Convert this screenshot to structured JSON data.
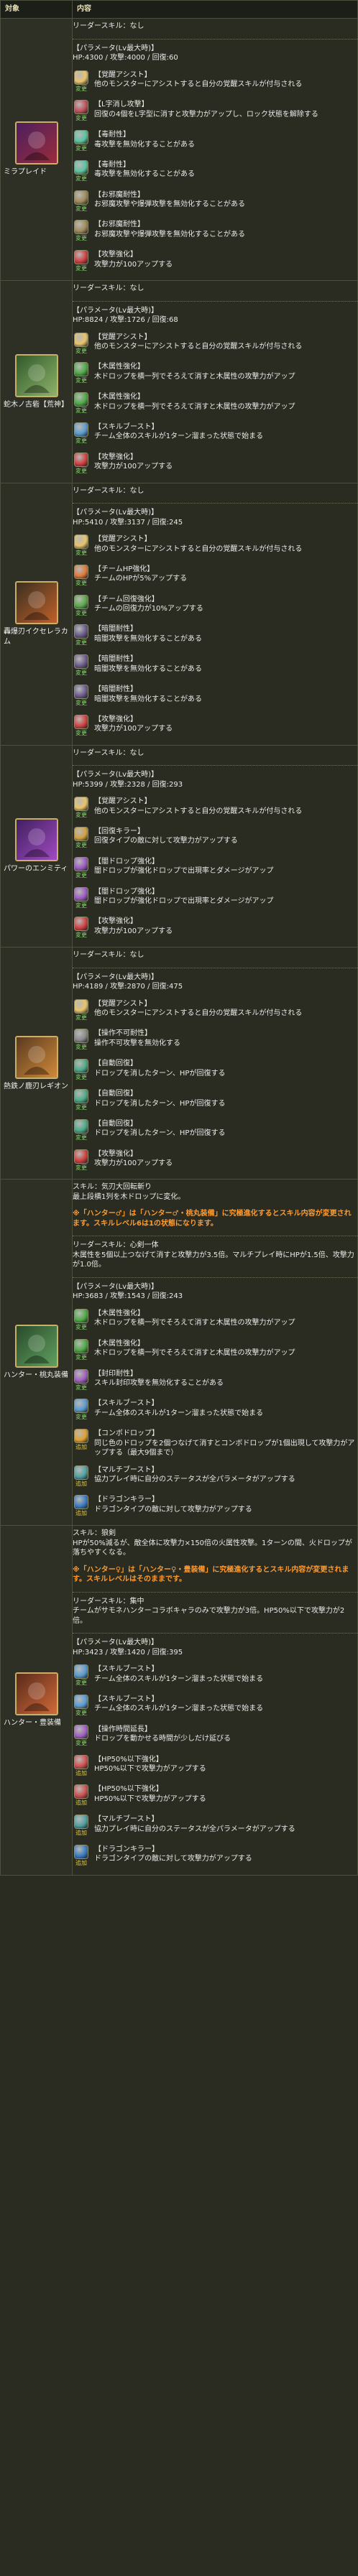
{
  "header": {
    "col1": "対象",
    "col2": "内容"
  },
  "colors": {
    "accent": "#ff9a2e",
    "border": "#4d5140",
    "frame": "#c9b06a"
  },
  "rows": [
    {
      "name": "ミラプレイド",
      "avatar_colors": [
        "#4d1f5e",
        "#9a2c3c"
      ],
      "lines": [
        {
          "type": "plain",
          "text": "リーダースキル：なし"
        },
        {
          "type": "hr"
        },
        {
          "type": "plain",
          "text": "【パラメータ(Lv最大時)】\nHP:4300 / 攻撃:4000 / 回復:60"
        },
        {
          "type": "aw",
          "color": "#e8c36b",
          "tag": "変更",
          "title": "【覚醒アシスト】",
          "body": "他のモンスターにアシストすると自分の覚醒スキルが付与される"
        },
        {
          "type": "aw",
          "color": "#c0505a",
          "tag": "変更",
          "title": "【L字消し攻撃】",
          "body": "回復の4個をL字型に消すと攻撃力がアップし、ロック状態を解除する"
        },
        {
          "type": "aw",
          "color": "#59c3a0",
          "tag": "変更",
          "title": "【毒耐性】",
          "body": "毒攻撃を無効化することがある"
        },
        {
          "type": "aw",
          "color": "#59c3a0",
          "tag": "変更",
          "title": "【毒耐性】",
          "body": "毒攻撃を無効化することがある"
        },
        {
          "type": "aw",
          "color": "#a08a5a",
          "tag": "変更",
          "title": "【お邪魔耐性】",
          "body": "お邪魔攻撃や爆弾攻撃を無効化することがある"
        },
        {
          "type": "aw",
          "color": "#a08a5a",
          "tag": "変更",
          "title": "【お邪魔耐性】",
          "body": "お邪魔攻撃や爆弾攻撃を無効化することがある"
        },
        {
          "type": "aw",
          "color": "#d04040",
          "tag": "変更",
          "title": "【攻撃強化】",
          "body": "攻撃力が100アップする"
        }
      ]
    },
    {
      "name": "蛇木ノ古砦【荒神】",
      "avatar_colors": [
        "#2f5a2a",
        "#8fb26a"
      ],
      "lines": [
        {
          "type": "plain",
          "text": "リーダースキル：なし"
        },
        {
          "type": "hr"
        },
        {
          "type": "plain",
          "text": "【パラメータ(Lv最大時)】\nHP:8824 / 攻撃:1726 / 回復:68"
        },
        {
          "type": "aw",
          "color": "#e8c36b",
          "tag": "変更",
          "title": "【覚醒アシスト】",
          "body": "他のモンスターにアシストすると自分の覚醒スキルが付与される"
        },
        {
          "type": "aw",
          "color": "#4caa44",
          "tag": "変更",
          "title": "【木属性強化】",
          "body": "木ドロップを横一列でそろえて消すと木属性の攻撃力がアップ"
        },
        {
          "type": "aw",
          "color": "#4caa44",
          "tag": "変更",
          "title": "【木属性強化】",
          "body": "木ドロップを横一列でそろえて消すと木属性の攻撃力がアップ"
        },
        {
          "type": "aw",
          "color": "#5a9ad0",
          "tag": "変更",
          "title": "【スキルブースト】",
          "body": "チーム全体のスキルが1ターン溜まった状態で始まる"
        },
        {
          "type": "aw",
          "color": "#d04040",
          "tag": "変更",
          "title": "【攻撃強化】",
          "body": "攻撃力が100アップする"
        }
      ]
    },
    {
      "name": "轟爆刃イクセレラカム",
      "avatar_colors": [
        "#3a3020",
        "#c0602a"
      ],
      "lines": [
        {
          "type": "plain",
          "text": "リーダースキル：なし"
        },
        {
          "type": "hr"
        },
        {
          "type": "plain",
          "text": "【パラメータ(Lv最大時)】\nHP:5410 / 攻撃:3137 / 回復:245"
        },
        {
          "type": "aw",
          "color": "#e8c36b",
          "tag": "変更",
          "title": "【覚醒アシスト】",
          "body": "他のモンスターにアシストすると自分の覚醒スキルが付与される"
        },
        {
          "type": "aw",
          "color": "#e07a3a",
          "tag": "変更",
          "title": "【チームHP強化】",
          "body": "チームのHPが5%アップする"
        },
        {
          "type": "aw",
          "color": "#5aa84a",
          "tag": "変更",
          "title": "【チーム回復強化】",
          "body": "チームの回復力が10%アップする"
        },
        {
          "type": "aw",
          "color": "#6a5a8a",
          "tag": "変更",
          "title": "【暗闇耐性】",
          "body": "暗闇攻撃を無効化することがある"
        },
        {
          "type": "aw",
          "color": "#6a5a8a",
          "tag": "変更",
          "title": "【暗闇耐性】",
          "body": "暗闇攻撃を無効化することがある"
        },
        {
          "type": "aw",
          "color": "#6a5a8a",
          "tag": "変更",
          "title": "【暗闇耐性】",
          "body": "暗闇攻撃を無効化することがある"
        },
        {
          "type": "aw",
          "color": "#d04040",
          "tag": "変更",
          "title": "【攻撃強化】",
          "body": "攻撃力が100アップする"
        }
      ]
    },
    {
      "name": "パワーのエンミティ",
      "avatar_colors": [
        "#402060",
        "#a04ac0"
      ],
      "lines": [
        {
          "type": "plain",
          "text": "リーダースキル：なし"
        },
        {
          "type": "hr"
        },
        {
          "type": "plain",
          "text": "【パラメータ(Lv最大時)】\nHP:5399 / 攻撃:2328 / 回復:293"
        },
        {
          "type": "aw",
          "color": "#e8c36b",
          "tag": "変更",
          "title": "【覚醒アシスト】",
          "body": "他のモンスターにアシストすると自分の覚醒スキルが付与される"
        },
        {
          "type": "aw",
          "color": "#d0a040",
          "tag": "変更",
          "title": "【回復キラー】",
          "body": "回復タイプの敵に対して攻撃力がアップする"
        },
        {
          "type": "aw",
          "color": "#9a5ac0",
          "tag": "変更",
          "title": "【闇ドロップ強化】",
          "body": "闇ドロップが強化ドロップで出現率とダメージがアップ"
        },
        {
          "type": "aw",
          "color": "#9a5ac0",
          "tag": "変更",
          "title": "【闇ドロップ強化】",
          "body": "闇ドロップが強化ドロップで出現率とダメージがアップ"
        },
        {
          "type": "aw",
          "color": "#d04040",
          "tag": "変更",
          "title": "【攻撃強化】",
          "body": "攻撃力が100アップする"
        }
      ]
    },
    {
      "name": "熱鉄ノ鹿刃レギオン",
      "avatar_colors": [
        "#5a3a20",
        "#d08a3a"
      ],
      "lines": [
        {
          "type": "plain",
          "text": "リーダースキル：なし"
        },
        {
          "type": "hr"
        },
        {
          "type": "plain",
          "text": "【パラメータ(Lv最大時)】\nHP:4189 / 攻撃:2870 / 回復:475"
        },
        {
          "type": "aw",
          "color": "#e8c36b",
          "tag": "変更",
          "title": "【覚醒アシスト】",
          "body": "他のモンスターにアシストすると自分の覚醒スキルが付与される"
        },
        {
          "type": "aw",
          "color": "#8a8a8a",
          "tag": "変更",
          "title": "【操作不可耐性】",
          "body": "操作不可攻撃を無効化する"
        },
        {
          "type": "aw",
          "color": "#4caa88",
          "tag": "変更",
          "title": "【自動回復】",
          "body": "ドロップを消したターン、HPが回復する"
        },
        {
          "type": "aw",
          "color": "#4caa88",
          "tag": "変更",
          "title": "【自動回復】",
          "body": "ドロップを消したターン、HPが回復する"
        },
        {
          "type": "aw",
          "color": "#4caa88",
          "tag": "変更",
          "title": "【自動回復】",
          "body": "ドロップを消したターン、HPが回復する"
        },
        {
          "type": "aw",
          "color": "#d04040",
          "tag": "変更",
          "title": "【攻撃強化】",
          "body": "攻撃力が100アップする"
        }
      ]
    },
    {
      "name": "ハンター・桃丸装備",
      "avatar_colors": [
        "#2a4a2a",
        "#60a060"
      ],
      "lines": [
        {
          "type": "plain",
          "text": "スキル：気刃大回転斬り\n最上段横1列を木ドロップに変化。"
        },
        {
          "type": "accent",
          "text": "※「ハンター♂」は「ハンター♂・桃丸装備」に究極進化するとスキル内容が変更されます。スキルレベル6は1の状態になります。"
        },
        {
          "type": "hr"
        },
        {
          "type": "plain",
          "text": "リーダースキル：心剣一体\n木属性を5個以上つなげて消すと攻撃力が3.5倍。マルチプレイ時にHPが1.5倍、攻撃力が1.0倍。"
        },
        {
          "type": "hr"
        },
        {
          "type": "plain",
          "text": "【パラメータ(Lv最大時)】\nHP:3683 / 攻撃:1543 / 回復:243"
        },
        {
          "type": "aw",
          "color": "#4caa44",
          "tag": "変更",
          "title": "【木属性強化】",
          "body": "木ドロップを横一列でそろえて消すと木属性の攻撃力がアップ"
        },
        {
          "type": "aw",
          "color": "#4caa44",
          "tag": "変更",
          "title": "【木属性強化】",
          "body": "木ドロップを横一列でそろえて消すと木属性の攻撃力がアップ"
        },
        {
          "type": "aw",
          "color": "#a060c0",
          "tag": "変更",
          "title": "【封印耐性】",
          "body": "スキル封印攻撃を無効化することがある"
        },
        {
          "type": "aw",
          "color": "#5a9ad0",
          "tag": "変更",
          "title": "【スキルブースト】",
          "body": "チーム全体のスキルが1ターン溜まった状態で始まる"
        },
        {
          "type": "aw",
          "color": "#e0a030",
          "tag": "追加",
          "title": "【コンボドロップ】",
          "body": "同じ色のドロップを2個つなげて消すとコンボドロップが1個出現して攻撃力がアップする（最大9個まで）"
        },
        {
          "type": "aw",
          "color": "#50a0a0",
          "tag": "追加",
          "title": "【マルチブースト】",
          "body": "協力プレイ時に自分のステータスが全パラメータがアップする"
        },
        {
          "type": "aw",
          "color": "#3a7ac0",
          "tag": "追加",
          "title": "【ドラゴンキラー】",
          "body": "ドラゴンタイプの敵に対して攻撃力がアップする"
        }
      ]
    },
    {
      "name": "ハンター・豊装備",
      "avatar_colors": [
        "#5a2a1a",
        "#d06a3a"
      ],
      "lines": [
        {
          "type": "plain",
          "text": "スキル：狼剣\nHPが50%減るが、敵全体に攻撃力×150倍の火属性攻撃。1ターンの間、火ドロップが落ちやすくなる。"
        },
        {
          "type": "accent",
          "text": "※「ハンター♀」は「ハンター♀・豊装備」に究極進化するとスキル内容が変更されます。スキルレベルはそのままです。"
        },
        {
          "type": "hr"
        },
        {
          "type": "plain",
          "text": "リーダースキル：集中\nチームがサモネハンターコラボキャラのみで攻撃力が3倍。HP50%以下で攻撃力が2倍。"
        },
        {
          "type": "hr"
        },
        {
          "type": "plain",
          "text": "【パラメータ(Lv最大時)】\nHP:3423 / 攻撃:1420 / 回復:395"
        },
        {
          "type": "aw",
          "color": "#5a9ad0",
          "tag": "変更",
          "title": "【スキルブースト】",
          "body": "チーム全体のスキルが1ターン溜まった状態で始まる"
        },
        {
          "type": "aw",
          "color": "#5a9ad0",
          "tag": "変更",
          "title": "【スキルブースト】",
          "body": "チーム全体のスキルが1ターン溜まった状態で始まる"
        },
        {
          "type": "aw",
          "color": "#a060c0",
          "tag": "変更",
          "title": "【操作時間延長】",
          "body": "ドロップを動かせる時間が少しだけ延びる"
        },
        {
          "type": "aw",
          "color": "#d05050",
          "tag": "追加",
          "title": "【HP50%以下強化】",
          "body": "HP50%以下で攻撃力がアップする"
        },
        {
          "type": "aw",
          "color": "#d05050",
          "tag": "追加",
          "title": "【HP50%以下強化】",
          "body": "HP50%以下で攻撃力がアップする"
        },
        {
          "type": "aw",
          "color": "#50a0a0",
          "tag": "追加",
          "title": "【マルチブースト】",
          "body": "協力プレイ時に自分のステータスが全パラメータがアップする"
        },
        {
          "type": "aw",
          "color": "#3a7ac0",
          "tag": "追加",
          "title": "【ドラゴンキラー】",
          "body": "ドラゴンタイプの敵に対して攻撃力がアップする"
        }
      ]
    }
  ]
}
